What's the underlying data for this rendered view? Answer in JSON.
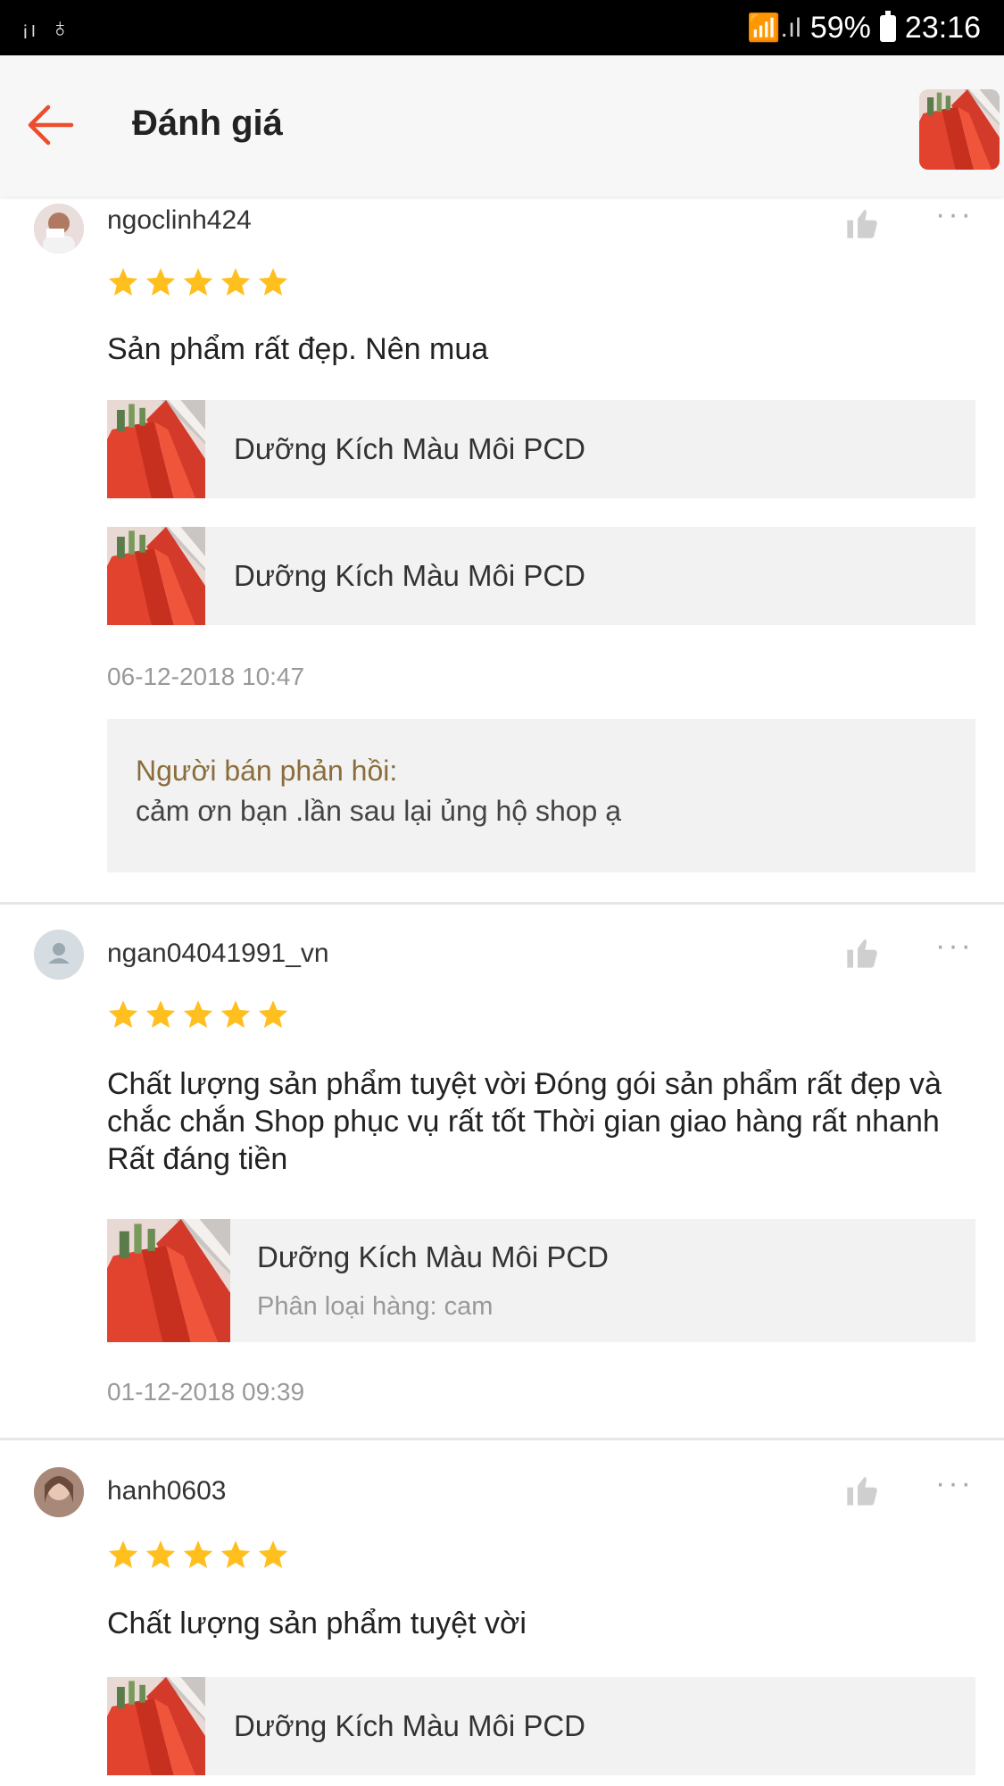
{
  "status_bar": {
    "left_icons": "ᵢₗ ♁",
    "signal_text": "📶.ıl",
    "battery_percent": "59%",
    "time": "23:16"
  },
  "app_bar": {
    "title": "Đánh giá"
  },
  "colors": {
    "accent": "#ee4d2d",
    "star": "#ffbf1f",
    "reply_label": "#8a6d3b"
  },
  "reviews": [
    {
      "username": "ngoclinh424",
      "rating": 5,
      "comment": "Sản phẩm rất đẹp. Nên mua",
      "products": [
        {
          "name": "Dưỡng Kích Màu Môi PCD"
        },
        {
          "name": "Dưỡng Kích Màu Môi PCD"
        }
      ],
      "timestamp": "06-12-2018 10:47",
      "seller_reply": {
        "label": "Người bán phản hồi:",
        "text": "cảm ơn bạn .lần sau lại ủng hộ shop ạ"
      }
    },
    {
      "username": "ngan04041991_vn",
      "rating": 5,
      "comment": " Chất lượng sản phẩm tuyệt vời Đóng gói sản phẩm rất đẹp và chắc chắn Shop phục vụ rất tốt Thời gian giao hàng rất nhanh Rất đáng tiền",
      "products": [
        {
          "name": "Dưỡng Kích Màu Môi PCD",
          "variant": "Phân loại hàng: cam"
        }
      ],
      "timestamp": "01-12-2018 09:39"
    },
    {
      "username": "hanh0603",
      "rating": 5,
      "comment": " Chất lượng sản phẩm tuyệt vời",
      "products": [
        {
          "name": "Dưỡng Kích Màu Môi PCD"
        }
      ]
    }
  ]
}
